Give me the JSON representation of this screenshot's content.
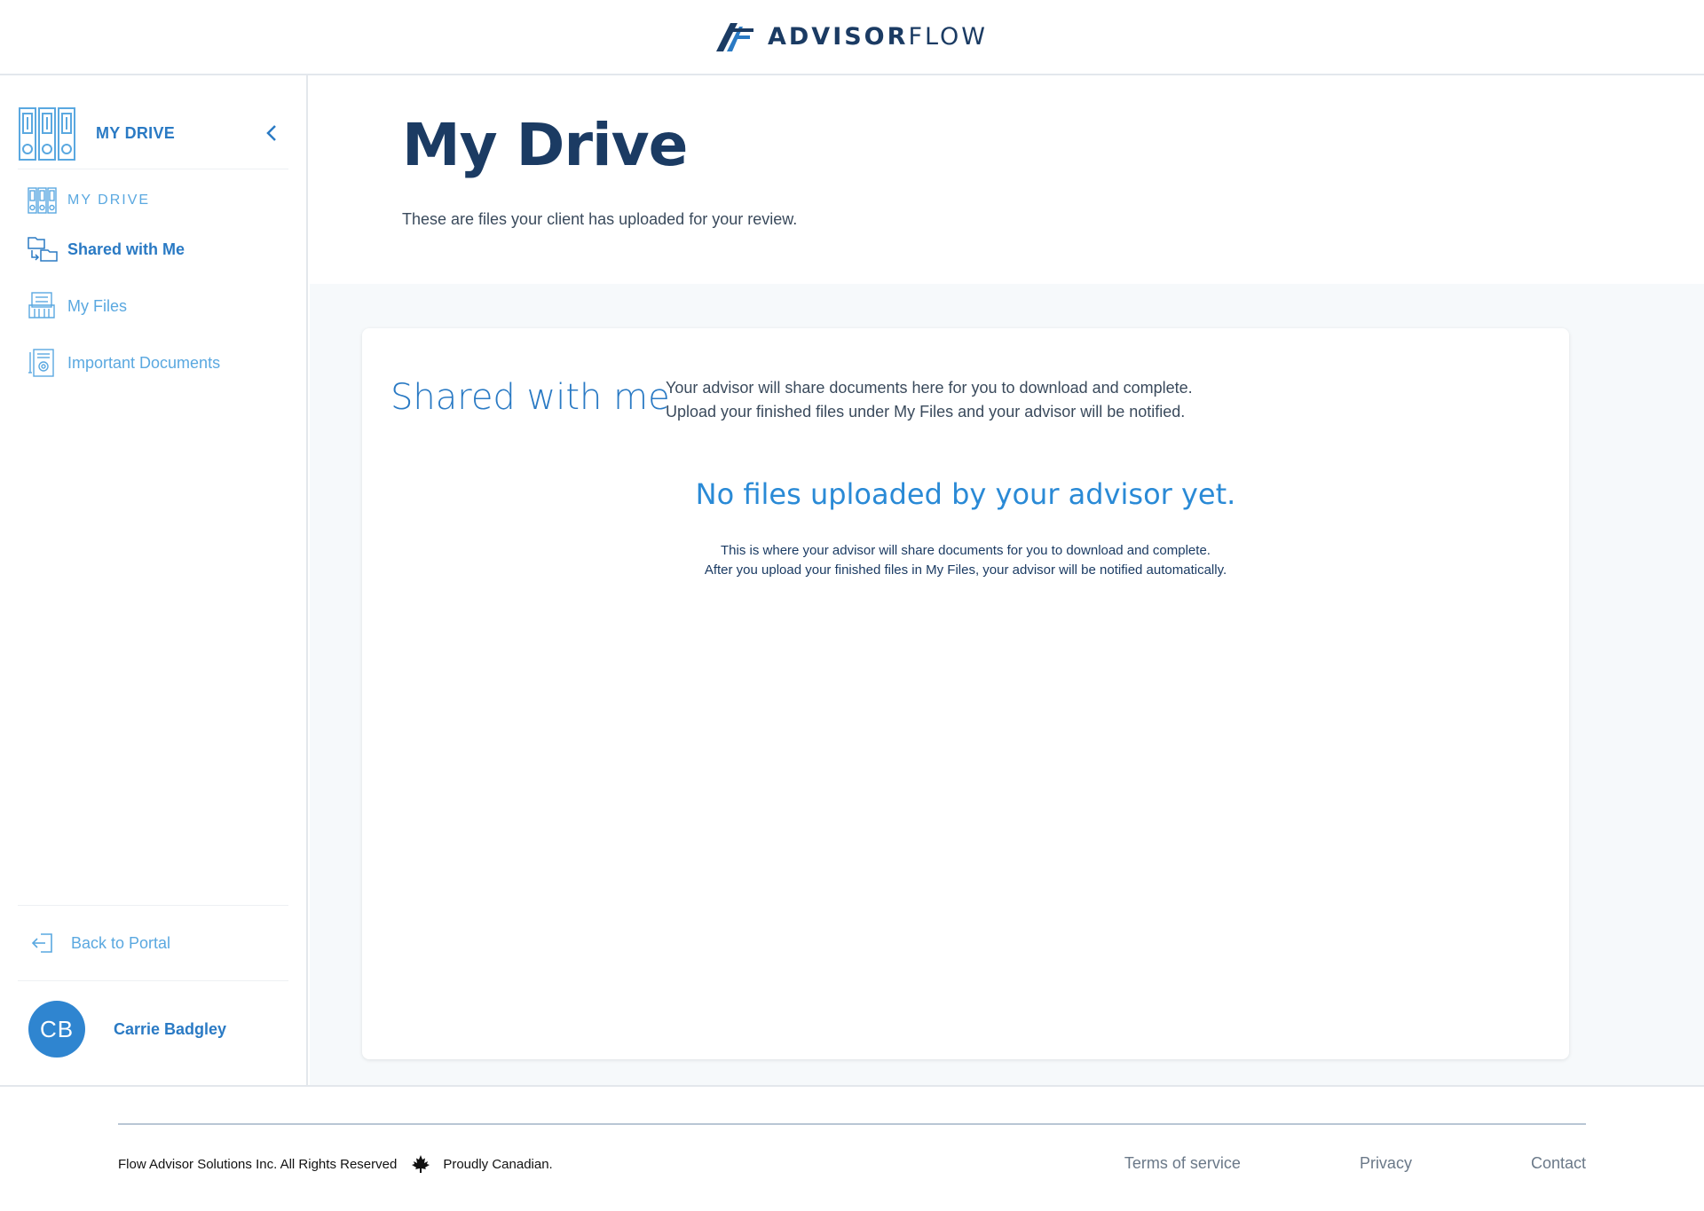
{
  "brand": {
    "name_bold": "ADVISOR",
    "name_light": "FLOW",
    "colors": {
      "navy": "#1b3b63",
      "accent": "#2a7ac4",
      "light_accent": "#5aa8e0",
      "avatar": "#2f85d0"
    }
  },
  "sidebar": {
    "header_title": "MY DRIVE",
    "header_icon": "binders-icon",
    "collapse_icon": "chevron-left-icon",
    "items": [
      {
        "label": "MY DRIVE",
        "icon": "binders-icon"
      },
      {
        "label": "Shared with Me",
        "icon": "shared-folders-icon"
      },
      {
        "label": "My Files",
        "icon": "file-cabinet-icon"
      },
      {
        "label": "Important Documents",
        "icon": "document-seal-icon"
      }
    ],
    "back_label": "Back to Portal",
    "back_icon": "exit-icon",
    "user": {
      "initials": "CB",
      "name": "Carrie Badgley"
    }
  },
  "main": {
    "title": "My Drive",
    "subtitle": "These are files your client has uploaded for your review.",
    "card": {
      "title": "Shared with me",
      "desc_line1": "Your advisor will share documents here for you to download and complete.",
      "desc_line2": "Upload your finished files under My Files and your advisor will be notified.",
      "empty_title": "No files uploaded by your advisor yet.",
      "empty_line1": "This is where your advisor will share documents for you to download and complete.",
      "empty_line2": "After you upload your finished files in My Files, your advisor will be notified automatically."
    }
  },
  "footer": {
    "copyright": "Flow Advisor Solutions Inc. All Rights Reserved",
    "tagline": "Proudly Canadian.",
    "leaf_icon": "maple-leaf-icon",
    "links": {
      "terms": "Terms of service",
      "privacy": "Privacy",
      "contact": "Contact"
    }
  }
}
